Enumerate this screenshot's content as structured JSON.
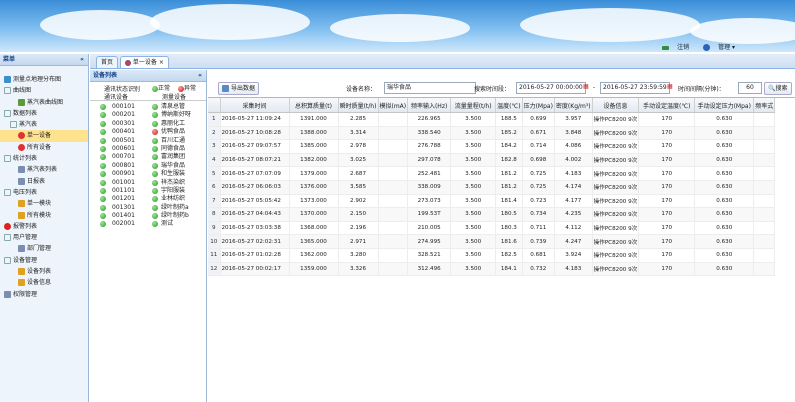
{
  "header": {
    "logout_label": "注销",
    "admin_label": "管理"
  },
  "menu": {
    "title": "菜单",
    "collapse_glyph": "«",
    "items": [
      {
        "label": "测量点地理分布图",
        "icon": "map-icon"
      },
      {
        "label": "曲线图",
        "icon": "expand-icon"
      },
      {
        "label": "蒸汽表曲线图",
        "icon": "chart-icon"
      },
      {
        "label": "数据列表",
        "icon": "expand-icon"
      },
      {
        "label": "蒸汽表",
        "icon": "expand-icon"
      },
      {
        "label": "单一设备",
        "icon": "device-icon"
      },
      {
        "label": "所有设备",
        "icon": "device-icon"
      },
      {
        "label": "统计列表",
        "icon": "expand-icon"
      },
      {
        "label": "蒸汽表列表",
        "icon": "doc-icon"
      },
      {
        "label": "日报表",
        "icon": "doc-icon"
      },
      {
        "label": "电压列表",
        "icon": "expand-icon"
      },
      {
        "label": "单一模块",
        "icon": "pen-icon"
      },
      {
        "label": "所有模块",
        "icon": "pen-icon"
      },
      {
        "label": "报警列表",
        "icon": "alarm-icon"
      },
      {
        "label": "用户管理",
        "icon": "expand-icon"
      },
      {
        "label": "部门管理",
        "icon": "doc-icon"
      },
      {
        "label": "设备管理",
        "icon": "expand-icon"
      },
      {
        "label": "设备列表",
        "icon": "pen-icon"
      },
      {
        "label": "设备信息",
        "icon": "pen-icon"
      },
      {
        "label": "权限管理",
        "icon": "doc-icon"
      }
    ]
  },
  "tabs": {
    "home": "首页",
    "active": "单一设备"
  },
  "device_panel": {
    "title": "设备列表",
    "legend_normal": "正常",
    "legend_alarm": "异常",
    "comm_status_label": "通讯状态识别",
    "col_comm": "通讯设备",
    "col_device": "测量设备",
    "devices": [
      {
        "code": "000101",
        "name": "清泉总管",
        "alarm": false
      },
      {
        "code": "000201",
        "name": "博纳斯好呀",
        "alarm": false
      },
      {
        "code": "000301",
        "name": "惠丽化工",
        "alarm": false
      },
      {
        "code": "000401",
        "name": "优鸭食品",
        "alarm": true
      },
      {
        "code": "000501",
        "name": "百川汇通",
        "alarm": false
      },
      {
        "code": "000601",
        "name": "同德食品",
        "alarm": false
      },
      {
        "code": "000701",
        "name": "富润集团",
        "alarm": false
      },
      {
        "code": "000801",
        "name": "瑞华食品",
        "alarm": false
      },
      {
        "code": "000901",
        "name": "和生服装",
        "alarm": false
      },
      {
        "code": "001001",
        "name": "祥杰染织",
        "alarm": false
      },
      {
        "code": "001101",
        "name": "宇阳服装",
        "alarm": false
      },
      {
        "code": "001201",
        "name": "业林纺织",
        "alarm": false
      },
      {
        "code": "001301",
        "name": "绿叶制药a",
        "alarm": false
      },
      {
        "code": "001401",
        "name": "绿叶制药b",
        "alarm": false
      },
      {
        "code": "002001",
        "name": "测试",
        "alarm": false
      }
    ]
  },
  "toolbar": {
    "export_label": "导出数据",
    "device_name_label": "设备名称：",
    "device_name_value": "瑞华食品",
    "time_range_label": "搜索时间段：",
    "start_time": "2016-05-27 00:00:00",
    "range_sep": "-",
    "end_time": "2016-05-27 23:59:59",
    "interval_label": "时间间隔(分钟)：",
    "interval_value": "60",
    "search_label": "搜索"
  },
  "table": {
    "columns": [
      "采集时间",
      "总积算质量(t)",
      "瞬时质量(t/h)",
      "模拟(mA)",
      "频率输入(Hz)",
      "流量量程(t/h)",
      "温度(℃)",
      "压力(Mpa)",
      "密度(Kg/m³)",
      "设备信息",
      "手动设定温度(℃)",
      "手动设定压力(Mpa)",
      "频率式"
    ],
    "rows": [
      [
        "2016-05-27 11:09:24",
        "1391.000",
        "2.285",
        "",
        "226.965",
        "3.500",
        "188.5",
        "0.699",
        "3.957",
        "操作PC8200 9次",
        "170",
        "0.630"
      ],
      [
        "2016-05-27 10:08:28",
        "1388.000",
        "3.314",
        "",
        "338.540",
        "3.500",
        "185.2",
        "0.671",
        "3.848",
        "操作PC8200 9次",
        "170",
        "0.630"
      ],
      [
        "2016-05-27 09:07:57",
        "1385.000",
        "2.978",
        "",
        "276.788",
        "3.500",
        "184.2",
        "0.714",
        "4.086",
        "操作PC8200 9次",
        "170",
        "0.630"
      ],
      [
        "2016-05-27 08:07:21",
        "1382.000",
        "3.025",
        "",
        "297.078",
        "3.500",
        "182.8",
        "0.698",
        "4.002",
        "操作PC8200 9次",
        "170",
        "0.630"
      ],
      [
        "2016-05-27 07:07:09",
        "1379.000",
        "2.687",
        "",
        "252.481",
        "3.500",
        "181.2",
        "0.725",
        "4.183",
        "操作PC8200 9次",
        "170",
        "0.630"
      ],
      [
        "2016-05-27 06:06:03",
        "1376.000",
        "3.585",
        "",
        "338.009",
        "3.500",
        "181.2",
        "0.725",
        "4.174",
        "操作PC8200 9次",
        "170",
        "0.630"
      ],
      [
        "2016-05-27 05:05:42",
        "1373.000",
        "2.902",
        "",
        "273.073",
        "3.500",
        "181.4",
        "0.723",
        "4.177",
        "操作PC8200 9次",
        "170",
        "0.630"
      ],
      [
        "2016-05-27 04:04:43",
        "1370.000",
        "2.150",
        "",
        "199.53T",
        "3.500",
        "180.5",
        "0.734",
        "4.235",
        "操作PC8200 9次",
        "170",
        "0.630"
      ],
      [
        "2016-05-27 03:03:38",
        "1368.000",
        "2.196",
        "",
        "210.005",
        "3.500",
        "180.3",
        "0.711",
        "4.112",
        "操作PC8200 9次",
        "170",
        "0.630"
      ],
      [
        "2016-05-27 02:02:31",
        "1365.000",
        "2.971",
        "",
        "274.995",
        "3.500",
        "181.6",
        "0.739",
        "4.247",
        "操作PC8200 9次",
        "170",
        "0.630"
      ],
      [
        "2016-05-27 01:02:28",
        "1362.000",
        "3.280",
        "",
        "328.521",
        "3.500",
        "182.5",
        "0.681",
        "3.924",
        "操作PC8200 9次",
        "170",
        "0.630"
      ],
      [
        "2016-05-27 00:02:17",
        "1359.000",
        "3.326",
        "",
        "312.496",
        "3.500",
        "184.1",
        "0.732",
        "4.183",
        "操作PC8200 9次",
        "170",
        "0.630"
      ]
    ]
  }
}
